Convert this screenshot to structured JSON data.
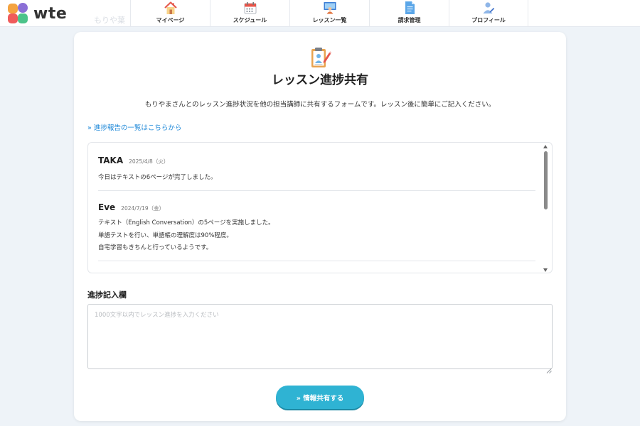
{
  "app": {
    "logo_text": "wte",
    "ghost_text": "もりや葉"
  },
  "nav": [
    {
      "label": "マイページ",
      "icon": "house-icon"
    },
    {
      "label": "スケジュール",
      "icon": "calendar-icon"
    },
    {
      "label": "レッスン一覧",
      "icon": "teacher-icon"
    },
    {
      "label": "請求管理",
      "icon": "document-icon"
    },
    {
      "label": "プロフィール",
      "icon": "user-icon"
    }
  ],
  "page": {
    "title": "レッスン進捗共有",
    "description": "もりやまさんとのレッスン進捗状況を他の担当講師に共有するフォームです。レッスン後に簡単にご記入ください。",
    "report_link": "» 進捗報告の一覧はこちらから"
  },
  "reports": [
    {
      "name": "TAKA",
      "date": "2025/4/8（火）",
      "lines": [
        "今日はテキストの6ページが完了しました。"
      ]
    },
    {
      "name": "Eve",
      "date": "2024/7/19（金）",
      "lines": [
        "テキスト（English Conversation）の5ページを実施しました。",
        "単語テストを行い、単語帳の理解度は90%程度。",
        "自宅学習もきちんと行っているようです。"
      ]
    }
  ],
  "form": {
    "section_label": "進捗記入欄",
    "placeholder": "1000文字以内でレッスン進捗を入力ください",
    "value": "",
    "submit_label": "» 情報共有する"
  },
  "colors": {
    "accent": "#2fb3d3",
    "link": "#1e88d8",
    "background": "#eef3f8"
  }
}
